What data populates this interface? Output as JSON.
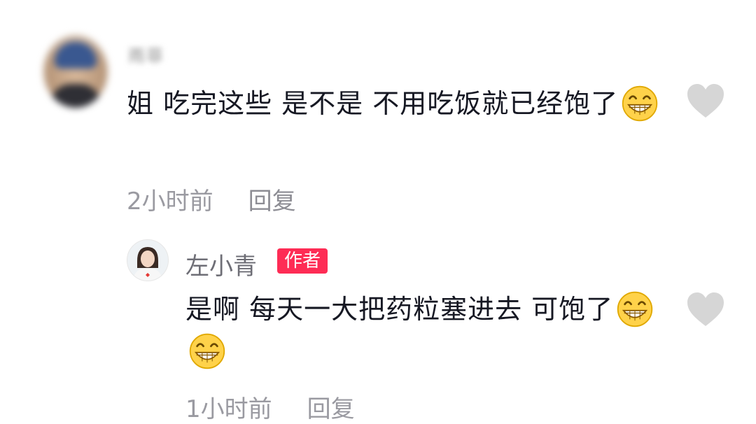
{
  "comment": {
    "author": "雨菲",
    "text": "姐 吃完这些 是不是 不用吃饭就已经饱了",
    "time": "2小时前",
    "reply_label": "回复"
  },
  "reply": {
    "author": "左小青",
    "badge": "作者",
    "text": "是啊 每天一大把药粒塞进去 可饱了",
    "time": "1小时前",
    "reply_label": "回复"
  },
  "icons": {
    "like": "heart-icon",
    "emoji": "grin-emoji"
  },
  "colors": {
    "badge": "#fe2c55",
    "heart": "#d6d6d6",
    "meta": "#9a9aa1"
  }
}
